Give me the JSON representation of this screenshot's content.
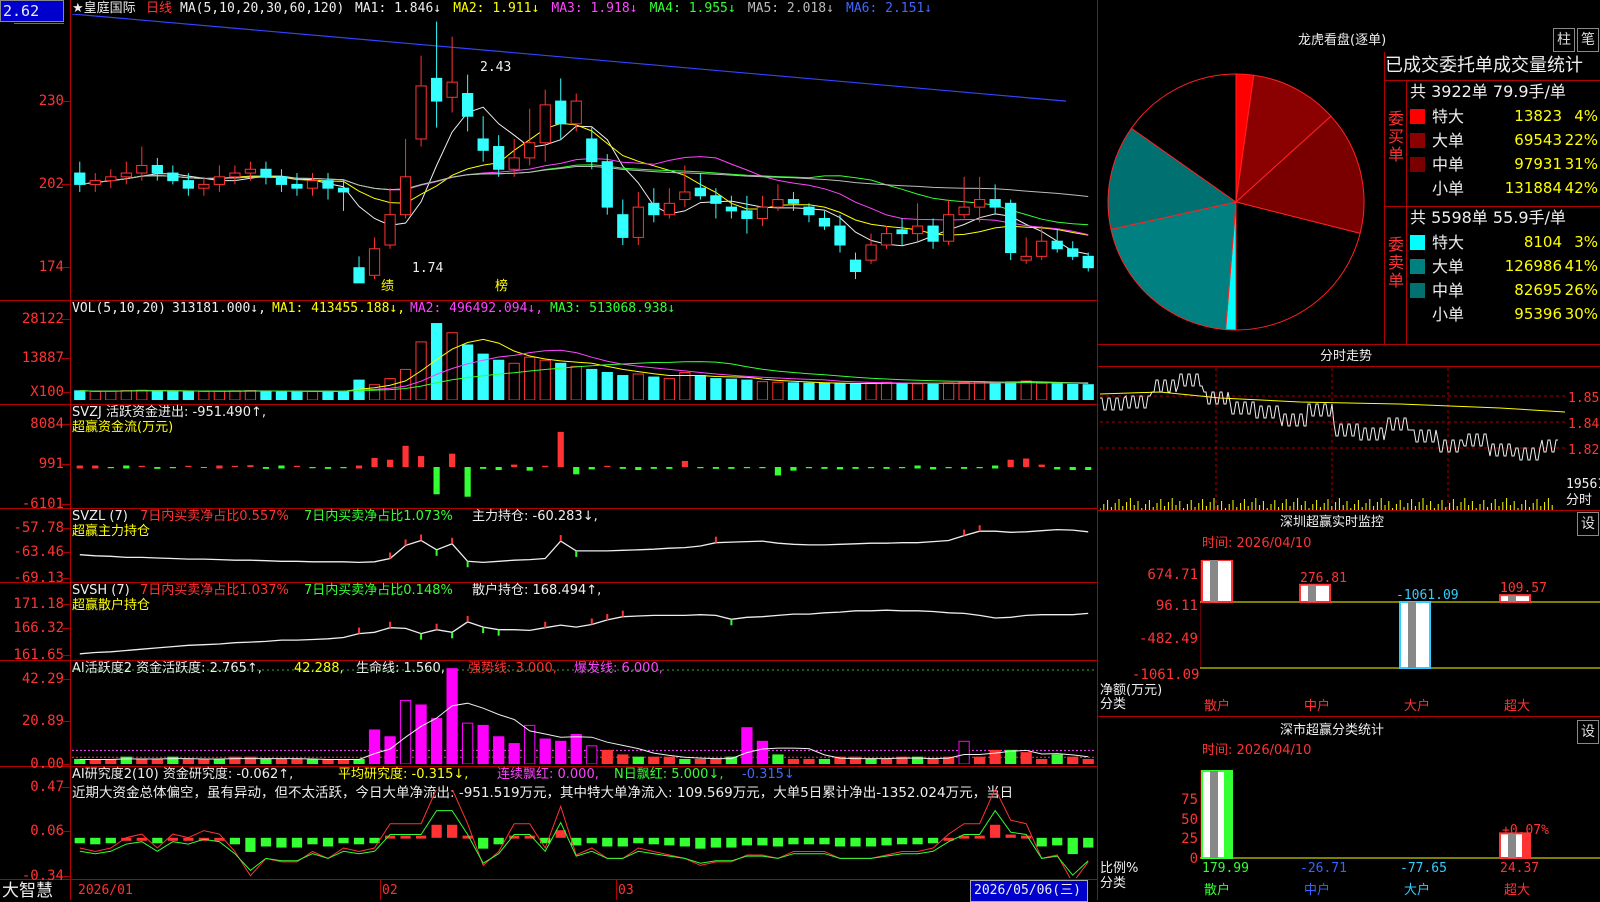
{
  "header": {
    "price_badge": "2.62",
    "title": "★皇庭国际",
    "period": "日线",
    "ma_label": "MA(5,10,20,30,60,120)",
    "ma_values": [
      {
        "text": "MA1: 1.846↓",
        "color": "#eeeeee"
      },
      {
        "text": "MA2: 1.911↓",
        "color": "#ffff00"
      },
      {
        "text": "MA3: 1.918↓",
        "color": "#ff44ff"
      },
      {
        "text": "MA4: 1.955↓",
        "color": "#33ff33"
      },
      {
        "text": "MA5: 2.018↓",
        "color": "#bbbbbb"
      },
      {
        "text": "MA6: 2.151↓",
        "color": "#4466ff"
      }
    ]
  },
  "main_chart": {
    "y_ticks": [
      "230",
      "202",
      "174"
    ],
    "high_marker": "2.43",
    "low_marker": "1.74",
    "events": [
      "绩",
      "榜"
    ]
  },
  "volume_panel": {
    "label": "VOL(5,10,20)",
    "value": "313181.000↓,",
    "ma1": "MA1: 413455.188↓,",
    "ma2": "MA2: 496492.094↓,",
    "ma3": "MA3: 513068.938↓",
    "y_ticks": [
      "28122",
      "13887",
      "X100"
    ]
  },
  "svzj_panel": {
    "label": "SVZJ  活跃资金进出: -951.490↑,",
    "sub": "超赢资金流(万元)",
    "y_ticks": [
      "8084",
      "991",
      "-6101"
    ]
  },
  "svzl_panel": {
    "label": "SVZL (7)",
    "seg1": "7日内买卖净占比0.557%",
    "seg2": "7日内买卖净占比1.073%",
    "seg3": "主力持仓: -60.283↓,",
    "sub": "超赢主力持仓",
    "y_ticks": [
      "-57.78",
      "-63.46",
      "-69.13"
    ]
  },
  "svsh_panel": {
    "label": "SVSH (7)",
    "seg1": "7日内买卖净占比1.037%",
    "seg2": "7日内买卖净占比0.148%",
    "seg3": "散户持仓: 168.494↑,",
    "sub": "超赢散户持仓",
    "y_ticks": [
      "171.18",
      "166.32",
      "161.65"
    ]
  },
  "ai_active_panel": {
    "label": "AI活跃度2 资金活跃度: 2.765↑,",
    "seg2": "42.288,",
    "seg3": "生命线: 1.560,",
    "seg4": "强势线: 3.000,",
    "seg5": "爆发线: 6.000,",
    "y_ticks": [
      "42.29",
      "20.89",
      "0.00"
    ]
  },
  "ai_research_panel": {
    "label": "AI研究度2(10) 资金研究度: -0.062↑,",
    "seg2": "平均研究度: -0.315↓,",
    "seg3": "连续飘红: 0.000,",
    "seg4": "N日飘红: 5.000↓,",
    "seg5": "-0.315↓",
    "summary": "近期大资金总体偏空，虽有异动，但不太活跃，今日大单净流出: -951.519万元，其中特大单净流入: 109.569万元，大单5日累计净出-1352.024万元，当日",
    "y_ticks": [
      "0.47",
      "0.06",
      "-0.34"
    ]
  },
  "bottom_bar": {
    "brand": "大智慧",
    "dates": [
      "2026/01",
      "02",
      "03"
    ],
    "current_date": "2026/05/06(三)"
  },
  "right_panel": {
    "tab_buttons": [
      "柱",
      "笔"
    ],
    "pie_title": "龙虎看盘(逐单)",
    "table_title": "已成交委托单成交量统计",
    "buy_side": {
      "side_label": "委买单",
      "summary": "共 3922单 79.9手/单",
      "rows": [
        {
          "name": "特大",
          "vol": "13823",
          "pct": "4%",
          "color": "#ff0000"
        },
        {
          "name": "大单",
          "vol": "69543",
          "pct": "22%",
          "color": "#8b0000"
        },
        {
          "name": "中单",
          "vol": "97931",
          "pct": "31%",
          "color": "#7a0000"
        },
        {
          "name": "小单",
          "vol": "131884",
          "pct": "42%",
          "color": "#000000"
        }
      ]
    },
    "sell_side": {
      "side_label": "委卖单",
      "summary": "共 5598单 55.9手/单",
      "rows": [
        {
          "name": "特大",
          "vol": "8104",
          "pct": "3%",
          "color": "#00ffff"
        },
        {
          "name": "大单",
          "vol": "126986",
          "pct": "41%",
          "color": "#008080"
        },
        {
          "name": "中单",
          "vol": "82695",
          "pct": "26%",
          "color": "#007070"
        },
        {
          "name": "小单",
          "vol": "95396",
          "pct": "30%",
          "color": "#000000"
        }
      ]
    },
    "intraday": {
      "title": "分时走势",
      "y_ticks": [
        "1.855",
        "1.840",
        "1.825"
      ],
      "vol_tick": "19561",
      "vol_label": "分时"
    },
    "monitor": {
      "title": "深圳超赢实时监控",
      "settings": "设",
      "time": "时间: 2026/04/10",
      "y_ticks": [
        "674.71",
        "96.11",
        "-482.49",
        "-1061.09"
      ],
      "y_unit": "净额(万元)",
      "x_unit": "分类",
      "categories": [
        "散户",
        "中户",
        "大户",
        "超大"
      ],
      "value_labels": [
        "674.71",
        "276.81",
        "-1061.09",
        "109.57"
      ]
    },
    "classify": {
      "title": "深市超赢分类统计",
      "settings": "设",
      "time": "时间: 2026/04/10",
      "y_ticks": [
        "75",
        "50",
        "25",
        "0"
      ],
      "y_unit": "比例%",
      "x_unit": "分类",
      "categories": [
        "散户",
        "中户",
        "大户",
        "超大"
      ],
      "value_labels": [
        "179.99",
        "-26.71",
        "-77.65",
        "24.37"
      ],
      "extra_label": "+0.07%"
    }
  },
  "chart_data": [
    {
      "type": "candlestick",
      "title": "皇庭国际 日线",
      "ylim": [
        1.7,
        2.45
      ],
      "candles": [
        [
          2.03,
          2.0,
          2.06,
          1.98
        ],
        [
          2.0,
          2.01,
          2.03,
          1.98
        ],
        [
          2.01,
          2.02,
          2.04,
          1.99
        ],
        [
          2.02,
          2.03,
          2.06,
          2.0
        ],
        [
          2.03,
          2.05,
          2.1,
          2.01
        ],
        [
          2.05,
          2.03,
          2.07,
          2.01
        ],
        [
          2.03,
          2.01,
          2.05,
          2.0
        ],
        [
          2.01,
          1.99,
          2.03,
          1.97
        ],
        [
          1.99,
          2.0,
          2.02,
          1.97
        ],
        [
          2.0,
          2.02,
          2.05,
          1.98
        ],
        [
          2.02,
          2.03,
          2.05,
          2.0
        ],
        [
          2.03,
          2.04,
          2.06,
          2.01
        ],
        [
          2.04,
          2.02,
          2.06,
          2.0
        ],
        [
          2.02,
          2.0,
          2.04,
          1.98
        ],
        [
          2.0,
          1.99,
          2.03,
          1.97
        ],
        [
          1.99,
          2.01,
          2.03,
          1.97
        ],
        [
          2.01,
          1.99,
          2.03,
          1.96
        ],
        [
          1.99,
          1.98,
          2.01,
          1.93
        ],
        [
          1.78,
          1.74,
          1.81,
          1.74
        ],
        [
          1.76,
          1.83,
          1.86,
          1.75
        ],
        [
          1.84,
          1.92,
          1.99,
          1.83
        ],
        [
          1.92,
          2.02,
          2.12,
          1.91
        ],
        [
          2.12,
          2.26,
          2.34,
          2.1
        ],
        [
          2.28,
          2.22,
          2.43,
          2.15
        ],
        [
          2.23,
          2.27,
          2.39,
          2.19
        ],
        [
          2.24,
          2.18,
          2.29,
          2.14
        ],
        [
          2.12,
          2.09,
          2.18,
          2.06
        ],
        [
          2.1,
          2.04,
          2.13,
          2.02
        ],
        [
          2.04,
          2.07,
          2.12,
          2.02
        ],
        [
          2.07,
          2.11,
          2.2,
          2.05
        ],
        [
          2.11,
          2.21,
          2.25,
          2.06
        ],
        [
          2.22,
          2.16,
          2.28,
          2.12
        ],
        [
          2.16,
          2.22,
          2.24,
          2.14
        ],
        [
          2.12,
          2.06,
          2.15,
          2.04
        ],
        [
          2.06,
          1.94,
          2.08,
          1.92
        ],
        [
          1.92,
          1.86,
          1.96,
          1.84
        ],
        [
          1.86,
          1.94,
          1.98,
          1.84
        ],
        [
          1.95,
          1.92,
          1.99,
          1.9
        ],
        [
          1.92,
          1.95,
          1.99,
          1.91
        ],
        [
          1.96,
          1.98,
          2.05,
          1.94
        ],
        [
          1.99,
          1.97,
          2.03,
          1.96
        ],
        [
          1.97,
          1.95,
          1.99,
          1.91
        ],
        [
          1.94,
          1.93,
          1.97,
          1.91
        ],
        [
          1.93,
          1.91,
          1.97,
          1.87
        ],
        [
          1.91,
          1.94,
          1.97,
          1.89
        ],
        [
          1.94,
          1.96,
          2.0,
          1.93
        ],
        [
          1.96,
          1.95,
          1.98,
          1.93
        ],
        [
          1.94,
          1.92,
          1.95,
          1.9
        ],
        [
          1.91,
          1.89,
          1.93,
          1.88
        ],
        [
          1.89,
          1.84,
          1.92,
          1.82
        ],
        [
          1.8,
          1.77,
          1.82,
          1.75
        ],
        [
          1.8,
          1.84,
          1.87,
          1.79
        ],
        [
          1.84,
          1.87,
          1.89,
          1.83
        ],
        [
          1.88,
          1.87,
          1.91,
          1.84
        ],
        [
          1.87,
          1.89,
          1.95,
          1.85
        ],
        [
          1.89,
          1.85,
          1.91,
          1.83
        ],
        [
          1.85,
          1.92,
          1.96,
          1.84
        ],
        [
          1.92,
          1.94,
          2.02,
          1.91
        ],
        [
          1.94,
          1.96,
          2.02,
          1.9
        ],
        [
          1.96,
          1.94,
          2.0,
          1.92
        ],
        [
          1.95,
          1.82,
          1.96,
          1.8
        ],
        [
          1.8,
          1.81,
          1.86,
          1.79
        ],
        [
          1.81,
          1.85,
          1.89,
          1.8
        ],
        [
          1.85,
          1.83,
          1.88,
          1.82
        ],
        [
          1.83,
          1.81,
          1.85,
          1.8
        ],
        [
          1.81,
          1.78,
          1.82,
          1.77
        ]
      ]
    },
    {
      "type": "bar",
      "title": "VOL(5,10,20)",
      "unit": "X100",
      "ylim": [
        0,
        28122
      ],
      "values": [
        3000,
        2800,
        2900,
        3100,
        3200,
        3000,
        2900,
        2700,
        2800,
        2900,
        3000,
        3100,
        2900,
        2800,
        2700,
        2800,
        2900,
        2800,
        6500,
        5000,
        7000,
        10000,
        19000,
        25000,
        22000,
        18000,
        15000,
        13000,
        12000,
        14000,
        13000,
        12000,
        11000,
        10000,
        9000,
        8000,
        8500,
        7500,
        7000,
        9000,
        8000,
        7000,
        6800,
        6500,
        6000,
        5800,
        5600,
        5500,
        5400,
        5300,
        5200,
        5600,
        5800,
        5400,
        5300,
        5200,
        5600,
        5800,
        6000,
        5800,
        5900,
        6200,
        5500,
        5300,
        5100,
        5000
      ],
      "colors_up": "#ff3333",
      "colors_down": "#33ffff"
    },
    {
      "type": "bar",
      "title": "SVZJ 活跃资金进出",
      "ylim": [
        -6101,
        8084
      ],
      "values": [
        0,
        0,
        -200,
        -100,
        200,
        -300,
        -200,
        200,
        -150,
        0,
        200,
        300,
        -300,
        -100,
        200,
        -200,
        -300,
        -200,
        0,
        1500,
        1200,
        3500,
        1800,
        -4500,
        2200,
        -4900,
        -300,
        -500,
        400,
        -600,
        200,
        5800,
        -1200,
        -400,
        200,
        -300,
        -500,
        -300,
        -300,
        1000,
        -200,
        -300,
        -300,
        -200,
        -200,
        -1400,
        -600,
        -200,
        -300,
        -400,
        -300,
        -200,
        -300,
        -200,
        -100,
        -400,
        -200,
        -300,
        -200,
        -100,
        1200,
        1400,
        400,
        -400,
        -500,
        -500
      ]
    },
    {
      "type": "line",
      "title": "SVZL 主力持仓",
      "ylim": [
        -69.13,
        -57.78
      ],
      "values": [
        -64.5,
        -64.7,
        -64.8,
        -65.0,
        -65.0,
        -65.1,
        -65.2,
        -65.3,
        -65.3,
        -65.4,
        -65.5,
        -65.5,
        -65.6,
        -65.7,
        -65.7,
        -65.8,
        -65.8,
        -65.8,
        -65.9,
        -65.8,
        -65.2,
        -62.8,
        -61.9,
        -63.6,
        -62.5,
        -65.7,
        -65.9,
        -65.7,
        -65.5,
        -65.4,
        -65.2,
        -62.0,
        -63.8,
        -63.8,
        -63.8,
        -63.7,
        -63.6,
        -63.5,
        -63.3,
        -63.2,
        -62.9,
        -62.3,
        -62.2,
        -62.1,
        -62.0,
        -62.4,
        -62.6,
        -62.7,
        -62.7,
        -62.6,
        -62.5,
        -62.4,
        -62.4,
        -62.3,
        -62.3,
        -62.1,
        -61.9,
        -61.0,
        -60.2,
        -60.2,
        -60.4,
        -60.3,
        -60.1,
        -59.9,
        -60.0,
        -60.3
      ]
    },
    {
      "type": "line",
      "title": "SVSH 散户持仓",
      "ylim": [
        161.65,
        171.18
      ],
      "values": [
        162.3,
        162.5,
        162.6,
        162.8,
        163.0,
        163.2,
        163.4,
        163.6,
        163.7,
        163.8,
        164.0,
        164.1,
        164.2,
        164.4,
        164.4,
        164.5,
        164.6,
        164.8,
        165.4,
        165.6,
        166.3,
        166.2,
        165.4,
        166.0,
        165.6,
        167.2,
        166.4,
        166.0,
        166.0,
        165.9,
        166.3,
        166.7,
        166.4,
        166.8,
        167.5,
        168.0,
        168.1,
        168.2,
        168.2,
        168.2,
        168.3,
        168.2,
        167.6,
        167.9,
        168.0,
        168.2,
        168.4,
        168.4,
        168.6,
        168.7,
        168.9,
        168.9,
        169.0,
        168.9,
        168.9,
        168.8,
        168.6,
        168.5,
        168.2,
        167.8,
        167.9,
        168.2,
        168.3,
        168.3,
        168.3,
        168.5
      ]
    },
    {
      "type": "bar",
      "title": "AI活跃度2",
      "ylim": [
        0,
        42.29
      ],
      "values": [
        2,
        2,
        2,
        3,
        2,
        2,
        3,
        2,
        2,
        2,
        3,
        3,
        2,
        2,
        2,
        2,
        2,
        2,
        2,
        15,
        12,
        28,
        26,
        20,
        42,
        18,
        17,
        12,
        9,
        17,
        11,
        10,
        13,
        8,
        6,
        4,
        3,
        3,
        3,
        2,
        2,
        2,
        3,
        16,
        10,
        4,
        2,
        2,
        2,
        3,
        3,
        2,
        2,
        3,
        3,
        2,
        3,
        10,
        3,
        6,
        6,
        5,
        2,
        4,
        3,
        2
      ]
    },
    {
      "type": "bar",
      "title": "AI研究度2(10)",
      "ylim": [
        -0.34,
        0.47
      ],
      "values": [
        -0.02,
        -0.03,
        -0.02,
        0.01,
        0.02,
        -0.02,
        0.02,
        0.01,
        0.03,
        0.02,
        -0.03,
        -0.1,
        -0.05,
        -0.06,
        -0.06,
        -0.03,
        -0.05,
        -0.02,
        -0.03,
        -0.02,
        0.05,
        0.05,
        0.05,
        0.15,
        0.15,
        0.05,
        -0.07,
        -0.03,
        0.05,
        0.05,
        -0.02,
        0.1,
        -0.04,
        -0.02,
        -0.05,
        -0.05,
        -0.02,
        -0.03,
        -0.04,
        -0.05,
        -0.07,
        -0.06,
        -0.06,
        -0.04,
        -0.04,
        -0.05,
        -0.03,
        -0.03,
        -0.03,
        -0.05,
        -0.05,
        -0.05,
        -0.04,
        -0.03,
        -0.03,
        -0.02,
        0.02,
        0.05,
        0.05,
        0.15,
        0.06,
        0.05,
        -0.05,
        -0.04,
        -0.12,
        -0.06
      ]
    },
    {
      "type": "pie",
      "title": "龙虎看盘(逐单)",
      "labels": [
        "买特大",
        "买大单",
        "买中单",
        "买小单",
        "卖特大",
        "卖大单",
        "卖中单",
        "卖小单"
      ],
      "values": [
        13823,
        69543,
        97931,
        131884,
        8104,
        126986,
        82695,
        95396
      ]
    },
    {
      "type": "bar",
      "title": "深圳超赢实时监控",
      "categories": [
        "散户",
        "中户",
        "大户",
        "超大"
      ],
      "values": [
        674.71,
        276.81,
        -1061.09,
        109.57
      ],
      "ylim": [
        -1061.09,
        674.71
      ]
    },
    {
      "type": "bar",
      "title": "深市超赢分类统计",
      "categories": [
        "散户",
        "中户",
        "大户",
        "超大"
      ],
      "values": [
        179.99,
        -26.71,
        -77.65,
        24.37
      ],
      "ylim": [
        0,
        75
      ]
    }
  ]
}
